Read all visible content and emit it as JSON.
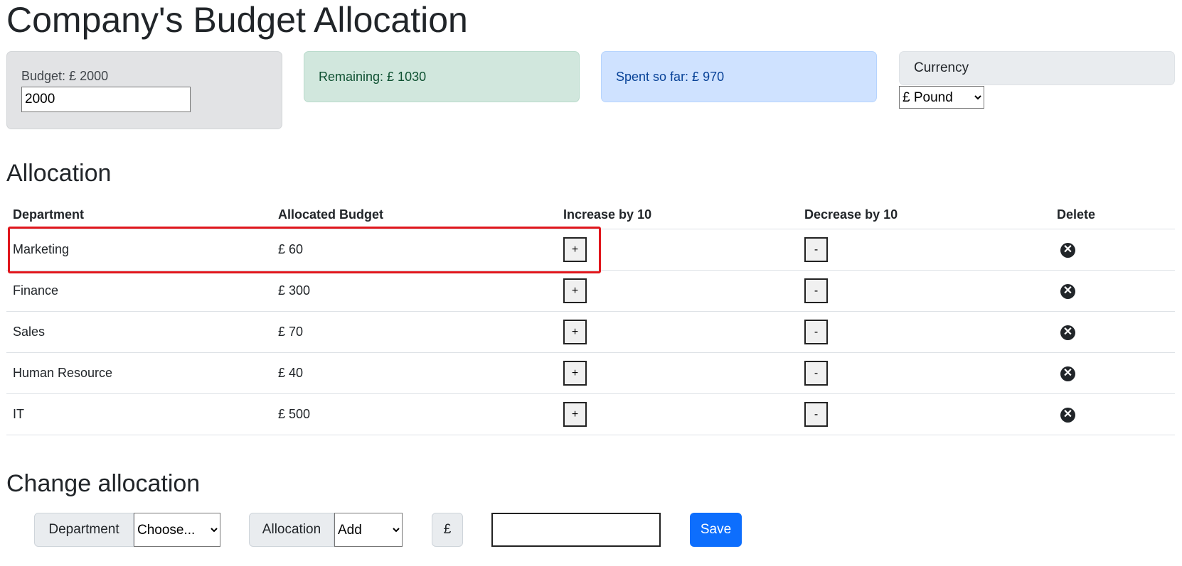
{
  "title": "Company's Budget Allocation",
  "budget": {
    "label": "Budget: £ 2000",
    "value": "2000"
  },
  "remaining": "Remaining: £ 1030",
  "spent": "Spent so far: £ 970",
  "currency": {
    "label": "Currency",
    "selected": "£ Pound"
  },
  "allocation": {
    "heading": "Allocation",
    "headers": [
      "Department",
      "Allocated Budget",
      "Increase by 10",
      "Decrease by 10",
      "Delete"
    ],
    "rows": [
      {
        "department": "Marketing",
        "budget": "£ 60"
      },
      {
        "department": "Finance",
        "budget": "£ 300"
      },
      {
        "department": "Sales",
        "budget": "£ 70"
      },
      {
        "department": "Human Resource",
        "budget": "£ 40"
      },
      {
        "department": "IT",
        "budget": "£ 500"
      }
    ],
    "plus": "+",
    "minus": "-",
    "delete_glyph": "✕"
  },
  "change": {
    "heading": "Change allocation",
    "department_label": "Department",
    "department_selected": "Choose...",
    "allocation_label": "Allocation",
    "allocation_selected": "Add",
    "currency_symbol": "£",
    "amount_value": "",
    "save": "Save"
  }
}
